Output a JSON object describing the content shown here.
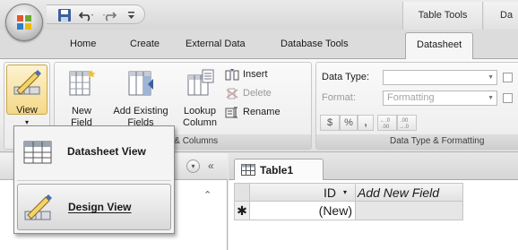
{
  "title_bar": {
    "context_tab_group": "Table Tools",
    "context_tab_group_2": "Da"
  },
  "quick_access": {
    "icons": [
      "save-icon",
      "undo-icon",
      "redo-icon",
      "customize-arrow-icon"
    ]
  },
  "tabs": [
    {
      "label": "Home",
      "active": false
    },
    {
      "label": "Create",
      "active": false
    },
    {
      "label": "External Data",
      "active": false
    },
    {
      "label": "Database Tools",
      "active": false
    },
    {
      "label": "Datasheet",
      "active": true
    }
  ],
  "ribbon": {
    "views": {
      "view_label": "View",
      "view_arrow": "▾"
    },
    "fields_columns": {
      "new_field": [
        "New",
        "Field"
      ],
      "add_existing": [
        "Add Existing",
        "Fields"
      ],
      "lookup_column": [
        "Lookup",
        "Column"
      ],
      "insert": "Insert",
      "delete": "Delete",
      "rename": "Rename",
      "group_label": "Fields & Columns"
    },
    "data_type_formatting": {
      "data_type_label": "Data Type:",
      "data_type_value": "",
      "format_label": "Format:",
      "format_value": "Formatting",
      "currency": "$",
      "percent": "%",
      "comma": ",",
      "increase_decimals": "←.0 .00",
      "decrease_decimals": ".00 →.0",
      "group_label": "Data Type & Formatting"
    }
  },
  "view_menu": {
    "items": [
      {
        "label": "Datasheet View",
        "mnemonic": "h",
        "icon": "datasheet-view-icon",
        "highlighted": false
      },
      {
        "label": "Design View",
        "mnemonic": "D",
        "icon": "design-view-icon",
        "highlighted": true
      }
    ]
  },
  "nav_pane": {
    "collapse_glyph": "«",
    "dropdown_glyph": "▾",
    "chevron_glyph": "⌃"
  },
  "document": {
    "tab_label": "Table1",
    "columns": [
      {
        "header": "ID",
        "sort_glyph": "▾"
      },
      {
        "header": "Add New Field",
        "sort_glyph": ""
      }
    ],
    "new_row": {
      "selector": "✱",
      "id_value": "(New)",
      "add_field_value": ""
    }
  }
}
